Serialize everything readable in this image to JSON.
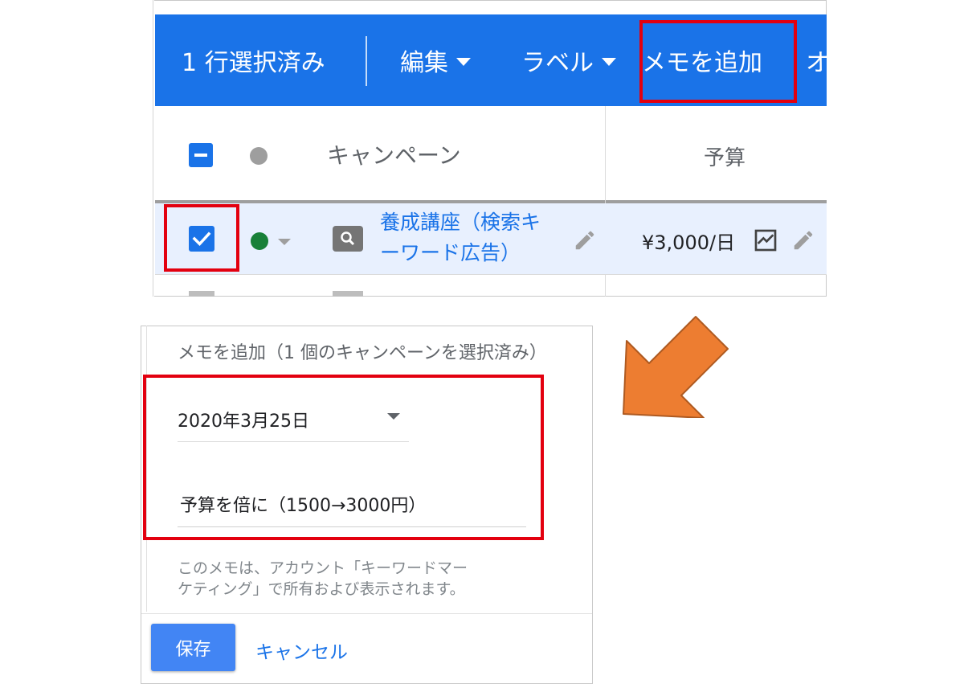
{
  "action_bar": {
    "selected_count": "1 行選択済み",
    "edit_label": "編集",
    "label_label": "ラベル",
    "add_memo_label": "メモを追加",
    "more_label": "オ"
  },
  "table": {
    "campaign_header": "キャンペーン",
    "budget_header": "予算",
    "row": {
      "campaign_name_line1": "養成講座（検索キ",
      "campaign_name_line2": "ーワード広告）",
      "budget": "¥3,000/日"
    }
  },
  "dialog": {
    "title": "メモを追加（1 個のキャンペーンを選択済み）",
    "date": "2020年3月25日",
    "memo": "予算を倍に（1500→3000円）",
    "info_line1": "このメモは、アカウント「キーワードマー",
    "info_line2": "ケティング」で所有および表示されます。",
    "save_label": "保存",
    "cancel_label": "キャンセル"
  },
  "colors": {
    "action_bar": "#1a73e8",
    "highlight": "#e3000f",
    "arrow": "#ed7d31",
    "status_active": "#188038"
  },
  "icons": [
    "chevron-down-icon",
    "checkbox-indeterminate-icon",
    "checkbox-checked-icon",
    "status-dot-icon",
    "search-icon",
    "edit-pencil-icon",
    "chart-icon",
    "arrow-down-left-icon"
  ]
}
